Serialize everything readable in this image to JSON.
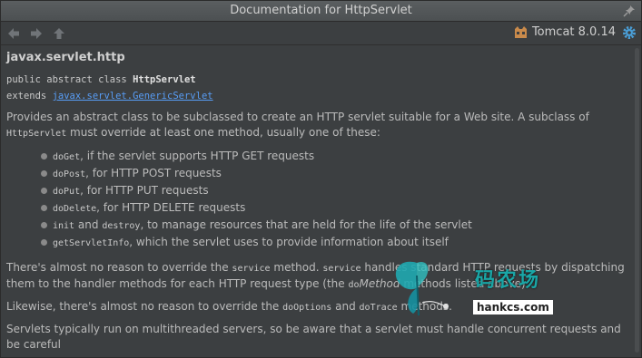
{
  "window": {
    "title": "Documentation for HttpServlet"
  },
  "toolbar": {
    "server_label": "Tomcat 8.0.14"
  },
  "doc": {
    "package": "javax.servlet.http",
    "declaration": {
      "prefix": "public abstract class ",
      "classname": "HttpServlet"
    },
    "extends": {
      "prefix": "extends ",
      "link": "javax.servlet.GenericServlet"
    },
    "intro": {
      "part1": "Provides an abstract class to be subclassed to create an HTTP servlet suitable for a Web site. A subclass of ",
      "code": "HttpServlet",
      "part2": " must override at least one method, usually one of these:"
    },
    "methods": [
      {
        "code": "doGet",
        "text": ", if the servlet supports HTTP GET requests"
      },
      {
        "code": "doPost",
        "text": ", for HTTP POST requests"
      },
      {
        "code": "doPut",
        "text": ", for HTTP PUT requests"
      },
      {
        "code": "doDelete",
        "text": ", for HTTP DELETE requests"
      },
      {
        "code": "init",
        "mid": " and ",
        "code2": "destroy",
        "text": ", to manage resources that are held for the life of the servlet"
      },
      {
        "code": "getServletInfo",
        "text": ", which the servlet uses to provide information about itself"
      }
    ],
    "para2": {
      "t1": "There's almost no reason to override the ",
      "c1": "service",
      "t2": " method. ",
      "c2": "service",
      "t3": " handles standard HTTP requests by dispatching them to the handler methods for each HTTP request type (the ",
      "c3": "do",
      "em": "Method",
      "t4": " methods listed above)."
    },
    "para3": {
      "t1": "Likewise, there's almost no reason to override the ",
      "c1": "doOptions",
      "t2": " and ",
      "c2": "doTrace",
      "t3": " methods."
    },
    "para4": "Servlets typically run on multithreaded servers, so be aware that a servlet must handle concurrent requests and be careful"
  },
  "watermark": {
    "text": "码农场",
    "sub": "hankcs.com"
  },
  "icons": {
    "back": "back-arrow-icon",
    "forward": "forward-arrow-icon",
    "up": "up-arrow-icon",
    "pin": "pin-icon",
    "server": "tomcat-icon",
    "settings": "gear-icon"
  }
}
